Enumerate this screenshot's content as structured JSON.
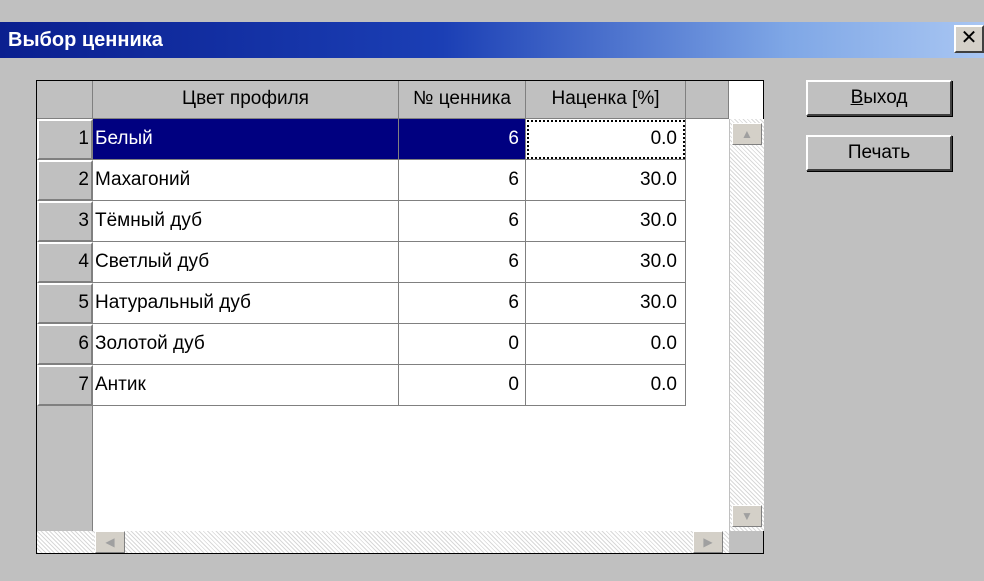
{
  "window": {
    "title": "Выбор ценника",
    "close_glyph": "✕"
  },
  "grid": {
    "columns": [
      "Цвет профиля",
      "№ ценника",
      "Наценка [%]"
    ],
    "rows": [
      {
        "index": "1",
        "name": "Белый",
        "number": "6",
        "markup": "0.0"
      },
      {
        "index": "2",
        "name": "Махагоний",
        "number": "6",
        "markup": "30.0"
      },
      {
        "index": "3",
        "name": "Тёмный дуб",
        "number": "6",
        "markup": "30.0"
      },
      {
        "index": "4",
        "name": "Светлый дуб",
        "number": "6",
        "markup": "30.0"
      },
      {
        "index": "5",
        "name": "Натуральный дуб",
        "number": "6",
        "markup": "30.0"
      },
      {
        "index": "6",
        "name": "Золотой дуб",
        "number": "0",
        "markup": "0.0"
      },
      {
        "index": "7",
        "name": "Антик",
        "number": "0",
        "markup": "0.0"
      }
    ],
    "scroll_icons": {
      "up": "up-arrow-icon",
      "down": "down-arrow-icon",
      "left": "left-arrow-icon",
      "right": "right-arrow-icon"
    }
  },
  "buttons": {
    "exit_access": "В",
    "exit_rest": "ыход",
    "print": "Печать"
  },
  "colors": {
    "selection": "#000080",
    "face": "#c0c0c0"
  }
}
